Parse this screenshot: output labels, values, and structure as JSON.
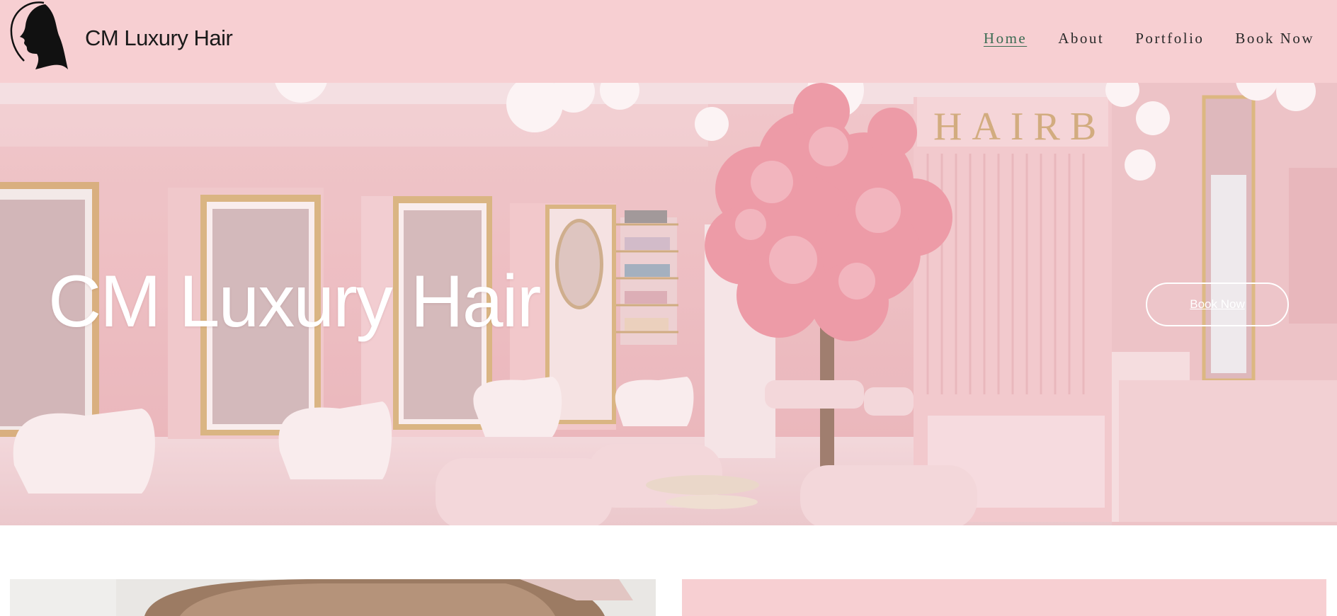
{
  "header": {
    "brand": "CM Luxury Hair",
    "logo_icon": "woman-silhouette-icon",
    "nav": [
      {
        "label": "Home",
        "active": true
      },
      {
        "label": "About",
        "active": false
      },
      {
        "label": "Portfolio",
        "active": false
      },
      {
        "label": "Book Now",
        "active": false
      }
    ]
  },
  "hero": {
    "title": "CM Luxury Hair",
    "button_label": "Book Now",
    "sign_text": "HAIRB"
  },
  "colors": {
    "header_bg": "#f7cfd2",
    "hero_text": "#ffffff",
    "active_nav": "#3a6b52"
  }
}
